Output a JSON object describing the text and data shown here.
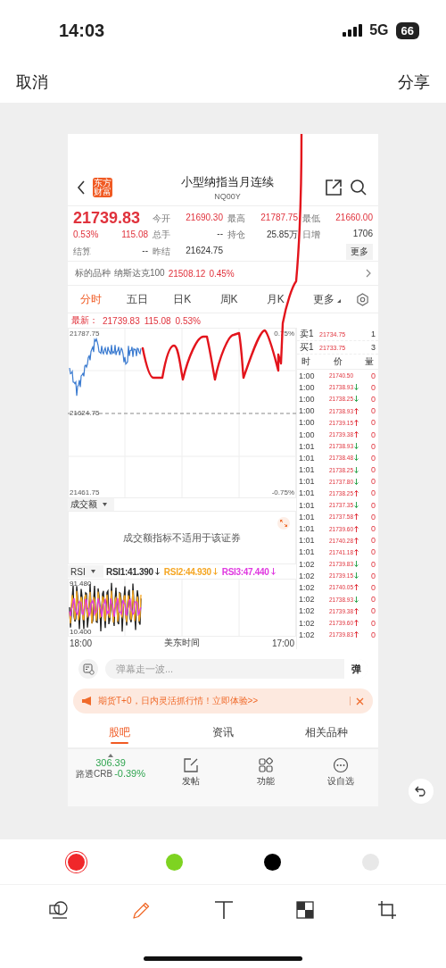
{
  "status_bar": {
    "time": "14:03",
    "network": "5G",
    "battery": "66"
  },
  "nav": {
    "cancel": "取消",
    "share": "分享"
  },
  "app": {
    "header": {
      "logo": "东方财富",
      "title": "小型纳指当月连续",
      "code": "NQ00Y"
    },
    "quote_rows": [
      [
        {
          "kind": "price",
          "value": "21739.83"
        },
        {
          "kind": "pair",
          "label": "今开",
          "value": "21690.30",
          "rising": true
        },
        {
          "kind": "pair",
          "label": "最高",
          "value": "21787.75",
          "rising": true
        },
        {
          "kind": "pair",
          "label": "最低",
          "value": "21660.00",
          "rising": true
        }
      ],
      [
        {
          "kind": "changes",
          "pct": "0.53%",
          "change": "115.08"
        },
        {
          "kind": "pair",
          "label": "总手",
          "value": "--",
          "rising": false
        },
        {
          "kind": "pair",
          "label": "持仓",
          "value": "25.85万",
          "rising": false
        },
        {
          "kind": "pair",
          "label": "日增",
          "value": "1706",
          "rising": false
        }
      ],
      [
        {
          "kind": "pair",
          "label": "结算",
          "value": "--",
          "rising": false
        },
        {
          "kind": "pair",
          "label": "昨结",
          "value": "21624.75",
          "rising": false
        },
        {
          "kind": "blank"
        },
        {
          "kind": "button",
          "label": "更多"
        }
      ]
    ],
    "underlying": {
      "label": "标的品种",
      "name": "纳斯达克100",
      "price": "21508.12",
      "pct": "0.45%"
    },
    "chart_tabs": [
      {
        "label": "分时",
        "selected": true,
        "dropdown": false
      },
      {
        "label": "五日",
        "selected": false,
        "dropdown": false
      },
      {
        "label": "日K",
        "selected": false,
        "dropdown": false
      },
      {
        "label": "周K",
        "selected": false,
        "dropdown": false
      },
      {
        "label": "月K",
        "selected": false,
        "dropdown": false
      },
      {
        "label": "更多",
        "selected": false,
        "dropdown": true
      }
    ],
    "latest": {
      "label": "最新：",
      "price": "21739.83",
      "change": "115.08",
      "pct": "0.53%"
    },
    "axis": {
      "high": "21787.75",
      "high_pct": "0.75%",
      "base": "21624.75",
      "low": "21461.75",
      "low_pct": "-0.75%"
    },
    "book": [
      {
        "side": "卖1",
        "price": "21734.75",
        "qty": "1"
      },
      {
        "side": "买1",
        "price": "21733.75",
        "qty": "3"
      }
    ],
    "ticks_header": [
      "时",
      "价",
      "量"
    ],
    "ticks": [
      {
        "time": "1:00",
        "price": "21740.50",
        "up": false,
        "down": false,
        "vol": "0"
      },
      {
        "time": "1:00",
        "price": "21738.93",
        "up": false,
        "down": true,
        "vol": "0"
      },
      {
        "time": "1:00",
        "price": "21738.25",
        "up": false,
        "down": true,
        "vol": "0"
      },
      {
        "time": "1:00",
        "price": "21738.93",
        "up": true,
        "down": false,
        "vol": "0"
      },
      {
        "time": "1:00",
        "price": "21739.15",
        "up": true,
        "down": false,
        "vol": "0"
      },
      {
        "time": "1:00",
        "price": "21739.38",
        "up": true,
        "down": false,
        "vol": "0"
      },
      {
        "time": "1:01",
        "price": "21738.93",
        "up": false,
        "down": true,
        "vol": "0"
      },
      {
        "time": "1:01",
        "price": "21738.48",
        "up": false,
        "down": true,
        "vol": "0"
      },
      {
        "time": "1:01",
        "price": "21738.25",
        "up": false,
        "down": true,
        "vol": "0"
      },
      {
        "time": "1:01",
        "price": "21737.80",
        "up": false,
        "down": true,
        "vol": "0"
      },
      {
        "time": "1:01",
        "price": "21738.25",
        "up": true,
        "down": false,
        "vol": "0"
      },
      {
        "time": "1:01",
        "price": "21737.35",
        "up": false,
        "down": true,
        "vol": "0"
      },
      {
        "time": "1:01",
        "price": "21737.58",
        "up": true,
        "down": false,
        "vol": "0"
      },
      {
        "time": "1:01",
        "price": "21739.60",
        "up": true,
        "down": false,
        "vol": "0"
      },
      {
        "time": "1:01",
        "price": "21740.28",
        "up": true,
        "down": false,
        "vol": "0"
      },
      {
        "time": "1:01",
        "price": "21741.18",
        "up": true,
        "down": false,
        "vol": "0"
      },
      {
        "time": "1:02",
        "price": "21739.83",
        "up": false,
        "down": true,
        "vol": "0"
      },
      {
        "time": "1:02",
        "price": "21739.15",
        "up": false,
        "down": true,
        "vol": "0"
      },
      {
        "time": "1:02",
        "price": "21740.05",
        "up": true,
        "down": false,
        "vol": "0"
      },
      {
        "time": "1:02",
        "price": "21738.93",
        "up": false,
        "down": true,
        "vol": "0"
      },
      {
        "time": "1:02",
        "price": "21739.38",
        "up": true,
        "down": false,
        "vol": "0"
      },
      {
        "time": "1:02",
        "price": "21739.60",
        "up": true,
        "down": false,
        "vol": "0"
      },
      {
        "time": "1:02",
        "price": "21739.83",
        "up": true,
        "down": false,
        "vol": "0"
      }
    ],
    "volume": {
      "selector": "成交额",
      "message": "成交额指标不适用于该证券"
    },
    "rsi": {
      "selector": "RSI",
      "values": [
        {
          "text": "RSI1:41.390",
          "color": "#333333"
        },
        {
          "text": "RSI2:44.930",
          "color": "#f5a623"
        },
        {
          "text": "RSI3:47.440",
          "color": "#e03ae0"
        }
      ],
      "max": "91.480",
      "min": "10.400"
    },
    "time_axis": {
      "start": "18:00",
      "zone": "美东时间",
      "end": "17:00"
    },
    "danmu": {
      "placeholder": "弹幕走一波...",
      "button": "弹"
    },
    "banner": {
      "text": "期货T+0，日内灵活抓行情！立即体验>>"
    },
    "bottom_tabs": [
      {
        "label": "股吧",
        "selected": true
      },
      {
        "label": "资讯",
        "selected": false
      },
      {
        "label": "相关品种",
        "selected": false
      }
    ],
    "footer": {
      "index_value": "306.39",
      "index_name": "路透CRB",
      "index_pct": "-0.39%",
      "actions": [
        {
          "label": "发帖",
          "kind": "post"
        },
        {
          "label": "功能",
          "kind": "grid"
        },
        {
          "label": "设自选",
          "kind": "more"
        }
      ]
    }
  },
  "palette": [
    {
      "color": "#f0272a",
      "selected": true
    },
    {
      "color": "#7ed321",
      "selected": false
    },
    {
      "color": "#000000",
      "selected": false
    },
    {
      "color": "#e8e8e8",
      "selected": false
    }
  ],
  "tools": [
    {
      "kind": "shapes",
      "selected": false
    },
    {
      "kind": "pencil",
      "selected": true
    },
    {
      "kind": "text",
      "selected": false
    },
    {
      "kind": "mosaic",
      "selected": false
    },
    {
      "kind": "crop",
      "selected": false
    }
  ]
}
